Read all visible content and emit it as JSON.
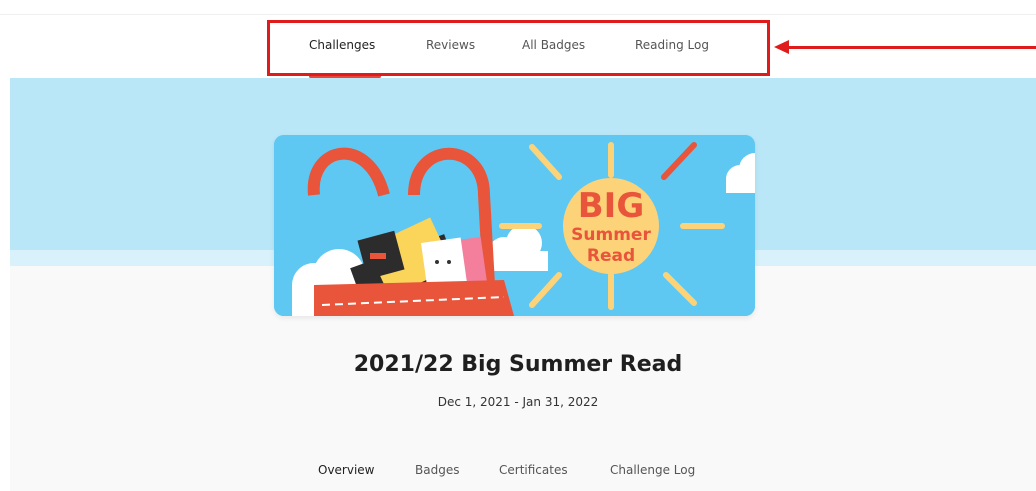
{
  "top_nav": {
    "items": [
      {
        "label": "Challenges",
        "active": true
      },
      {
        "label": "Reviews",
        "active": false
      },
      {
        "label": "All Badges",
        "active": false
      },
      {
        "label": "Reading Log",
        "active": false
      }
    ]
  },
  "banner": {
    "logo_line1": "BIG",
    "logo_line2": "Summer",
    "logo_line3": "Read"
  },
  "challenge": {
    "title": "2021/22 Big Summer Read",
    "dates": "Dec 1, 2021 - Jan 31, 2022"
  },
  "sub_tabs": [
    {
      "label": "Overview",
      "active": true
    },
    {
      "label": "Badges",
      "active": false
    },
    {
      "label": "Certificates",
      "active": false
    },
    {
      "label": "Challenge Log",
      "active": false
    }
  ],
  "colors": {
    "accent": "#e8473c",
    "annotation": "#e01b1b",
    "sky": "#b9e7f7",
    "banner_bg": "#5ec8f2",
    "sun": "#fdd37a"
  }
}
